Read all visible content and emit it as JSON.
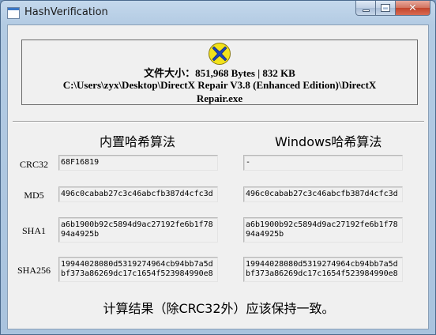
{
  "window": {
    "title": "HashVerification"
  },
  "file_info": {
    "size_line": "文件大小：851,968 Bytes | 832 KB",
    "path": "C:\\Users\\zyx\\Desktop\\DirectX Repair V3.8 (Enhanced Edition)\\DirectX Repair.exe"
  },
  "columns": {
    "builtin_header": "内置哈希算法",
    "windows_header": "Windows哈希算法"
  },
  "rows": [
    {
      "label": "CRC32",
      "builtin": "68F16819",
      "windows": "-"
    },
    {
      "label": "MD5",
      "builtin": "496c0cabab27c3c46abcfb387d4cfc3d",
      "windows": "496c0cabab27c3c46abcfb387d4cfc3d"
    },
    {
      "label": "SHA1",
      "builtin": "a6b1900b92c5894d9ac27192fe6b1f7894a4925b",
      "windows": "a6b1900b92c5894d9ac27192fe6b1f7894a4925b"
    },
    {
      "label": "SHA256",
      "builtin": "19944028080d5319274964cb94bb7a5dbf373a86269dc17c1654f523984990e8",
      "windows": "19944028080d5319274964cb94bb7a5dbf373a86269dc17c1654f523984990e8"
    }
  ],
  "footer_note": "计算结果（除CRC32外）应该保持一致。",
  "icons": {
    "app": "window-app-icon",
    "logo": "directx-repair-x-icon"
  },
  "colors": {
    "logo_fill": "#f2e21a",
    "logo_x": "#1d44b8",
    "title_bar": "#b9cfe6",
    "close_button": "#c3452c"
  }
}
